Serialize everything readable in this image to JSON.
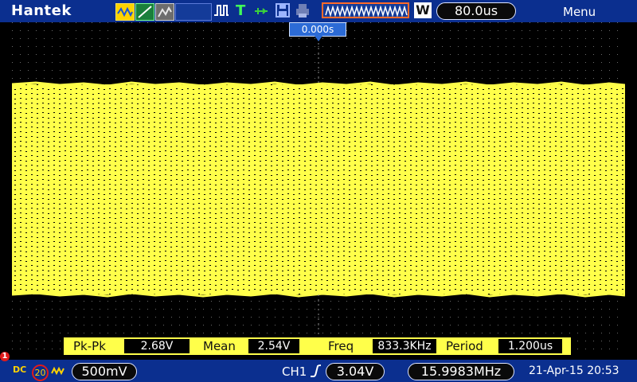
{
  "brand": "Hantek",
  "toolbar": {
    "icons": [
      "waveform-icon",
      "ramp-icon",
      "display-icon",
      "pulse-icon",
      "trigger-t-icon",
      "usb-icon",
      "save-icon",
      "print-icon"
    ],
    "window_label": "W",
    "timebase": "80.0us",
    "menu": "Menu"
  },
  "screen": {
    "trigger_position": "0.000s",
    "trace_color": "#ffff4a"
  },
  "measurements": [
    {
      "label": "Pk-Pk",
      "value": "2.68V"
    },
    {
      "label": "Mean",
      "value": "2.54V"
    },
    {
      "label": "Freq",
      "value": "833.3KHz"
    },
    {
      "label": "Period",
      "value": "1.200us"
    }
  ],
  "bottom": {
    "channel_marker": "1",
    "coupling": "DC",
    "bw_limit": "20",
    "volts_per_div": "500mV",
    "trigger_channel": "CH1",
    "trigger_level": "3.04V",
    "frequency": "15.9983MHz",
    "datetime": "21-Apr-15 20:53"
  }
}
